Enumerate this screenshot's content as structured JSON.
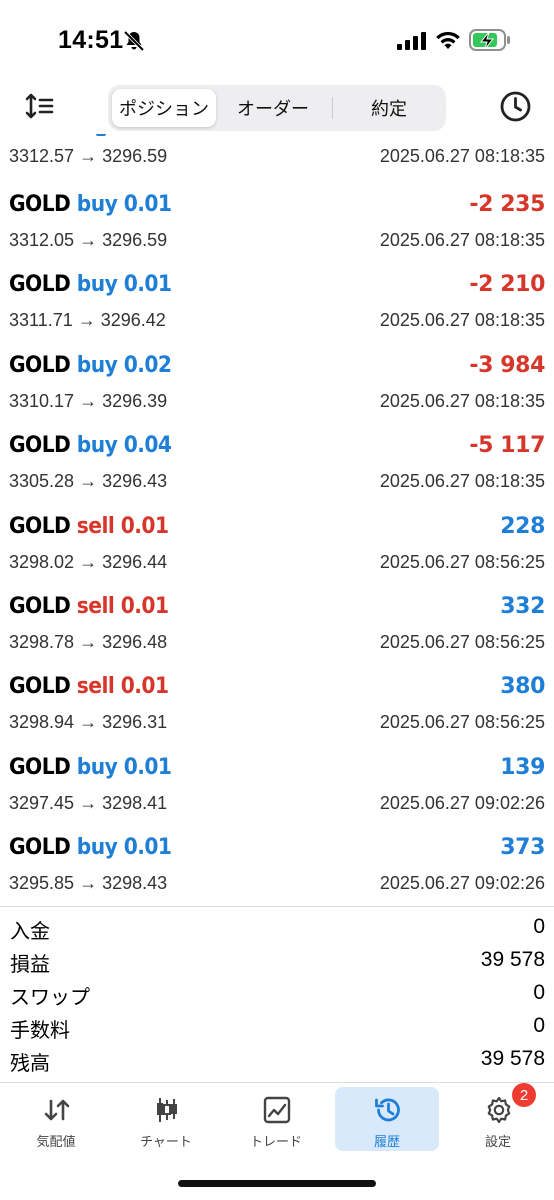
{
  "status_bar": {
    "time": "14:51"
  },
  "toolbar": {
    "tabs": [
      {
        "label": "ポジション",
        "active": true
      },
      {
        "label": "オーダー",
        "active": false
      },
      {
        "label": "約定",
        "active": false
      }
    ]
  },
  "trades": {
    "partial": {
      "prices": "3312.57 → 3296.59",
      "time": "2025.06.27 08:18:35"
    },
    "rows": [
      {
        "symbol": "GOLD",
        "direction": "buy 0.01",
        "side": "buy",
        "profit": "-2 235",
        "prices": "3312.05 → 3296.59",
        "time": "2025.06.27 08:18:35"
      },
      {
        "symbol": "GOLD",
        "direction": "buy 0.01",
        "side": "buy",
        "profit": "-2 210",
        "prices": "3311.71 → 3296.42",
        "time": "2025.06.27 08:18:35"
      },
      {
        "symbol": "GOLD",
        "direction": "buy 0.02",
        "side": "buy",
        "profit": "-3 984",
        "prices": "3310.17 → 3296.39",
        "time": "2025.06.27 08:18:35"
      },
      {
        "symbol": "GOLD",
        "direction": "buy 0.04",
        "side": "buy",
        "profit": "-5 117",
        "prices": "3305.28 → 3296.43",
        "time": "2025.06.27 08:18:35"
      },
      {
        "symbol": "GOLD",
        "direction": "sell 0.01",
        "side": "sell",
        "profit": "228",
        "prices": "3298.02 → 3296.44",
        "time": "2025.06.27 08:56:25"
      },
      {
        "symbol": "GOLD",
        "direction": "sell 0.01",
        "side": "sell",
        "profit": "332",
        "prices": "3298.78 → 3296.48",
        "time": "2025.06.27 08:56:25"
      },
      {
        "symbol": "GOLD",
        "direction": "sell 0.01",
        "side": "sell",
        "profit": "380",
        "prices": "3298.94 → 3296.31",
        "time": "2025.06.27 08:56:25"
      },
      {
        "symbol": "GOLD",
        "direction": "buy 0.01",
        "side": "buy",
        "profit": "139",
        "prices": "3297.45 → 3298.41",
        "time": "2025.06.27 09:02:26"
      },
      {
        "symbol": "GOLD",
        "direction": "buy 0.01",
        "side": "buy",
        "profit": "373",
        "prices": "3295.85 → 3298.43",
        "time": "2025.06.27 09:02:26"
      }
    ]
  },
  "summary": [
    {
      "label": "入金",
      "value": "0"
    },
    {
      "label": "損益",
      "value": "39 578"
    },
    {
      "label": "スワップ",
      "value": "0"
    },
    {
      "label": "手数料",
      "value": "0"
    },
    {
      "label": "残高",
      "value": "39 578"
    }
  ],
  "tabbar": {
    "items": [
      {
        "label": "気配値",
        "icon": "quotes-icon"
      },
      {
        "label": "チャート",
        "icon": "chart-icon"
      },
      {
        "label": "トレード",
        "icon": "trade-icon"
      },
      {
        "label": "履歴",
        "icon": "history-icon",
        "active": true
      },
      {
        "label": "設定",
        "icon": "settings-icon",
        "badge": "2"
      }
    ]
  },
  "colors": {
    "buy": "#1f7fd6",
    "sell": "#d7362b",
    "active_tab_bg": "#d8e9fb",
    "badge": "#ef3b30"
  }
}
